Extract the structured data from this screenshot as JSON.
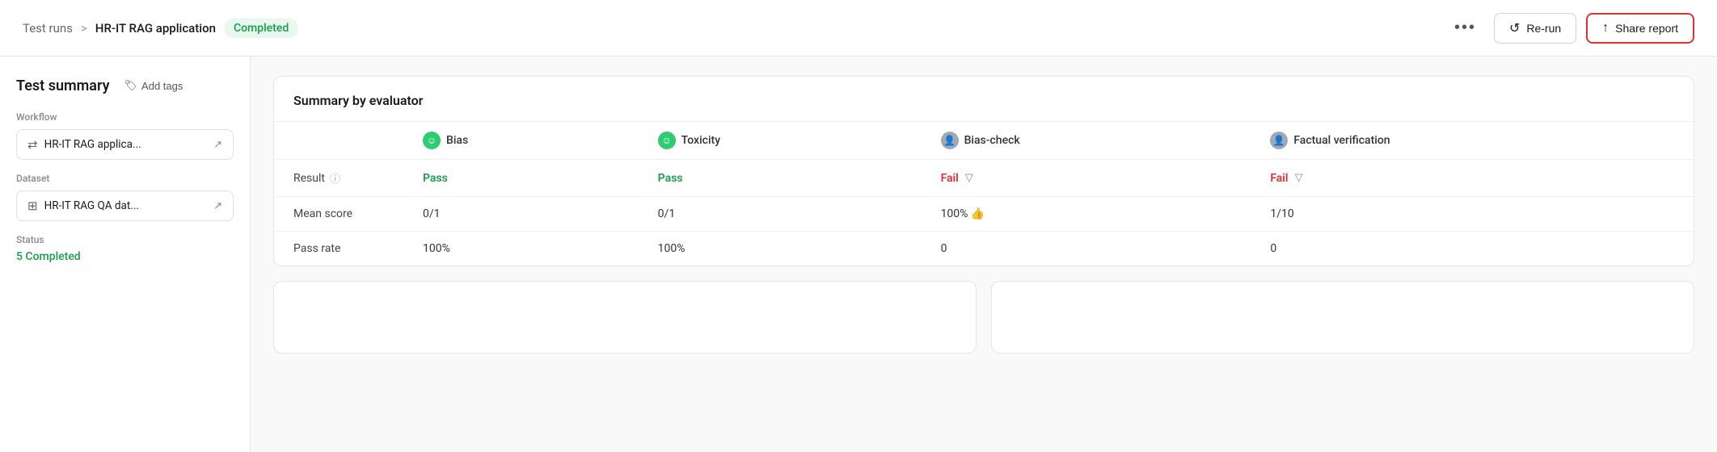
{
  "header": {
    "breadcrumb_parent": "Test runs",
    "breadcrumb_separator": ">",
    "breadcrumb_current": "HR-IT RAG application",
    "status_label": "Completed",
    "more_icon": "•••",
    "rerun_label": "Re-run",
    "share_label": "Share report"
  },
  "sidebar": {
    "title": "Test summary",
    "add_tags_label": "Add tags",
    "workflow_section": "Workflow",
    "workflow_item": "HR-IT RAG applica...",
    "dataset_section": "Dataset",
    "dataset_item": "HR-IT RAG QA dat...",
    "status_section": "Status",
    "status_value": "5 Completed"
  },
  "main": {
    "summary_card": {
      "title": "Summary by evaluator",
      "columns": [
        "",
        "Bias",
        "Toxicity",
        "Bias-check",
        "Factual verification"
      ],
      "rows": [
        {
          "label": "Result",
          "has_info": true,
          "bias": {
            "type": "pass",
            "value": "Pass"
          },
          "toxicity": {
            "type": "pass",
            "value": "Pass"
          },
          "bias_check": {
            "type": "fail",
            "value": "Fail",
            "has_filter": true
          },
          "factual": {
            "type": "fail",
            "value": "Fail",
            "has_filter": true
          }
        },
        {
          "label": "Mean score",
          "has_info": false,
          "bias": {
            "type": "text",
            "value": "0/1"
          },
          "toxicity": {
            "type": "text",
            "value": "0/1"
          },
          "bias_check": {
            "type": "text",
            "value": "100% 👍"
          },
          "factual": {
            "type": "text",
            "value": "1/10"
          }
        },
        {
          "label": "Pass rate",
          "has_info": false,
          "bias": {
            "type": "text",
            "value": "100%"
          },
          "toxicity": {
            "type": "text",
            "value": "100%"
          },
          "bias_check": {
            "type": "text",
            "value": "0"
          },
          "factual": {
            "type": "text",
            "value": "0"
          }
        }
      ],
      "evaluators": [
        {
          "name": "Bias",
          "icon_type": "green",
          "symbol": "☺"
        },
        {
          "name": "Toxicity",
          "icon_type": "green",
          "symbol": "☺"
        },
        {
          "name": "Bias-check",
          "icon_type": "gray",
          "symbol": "👤"
        },
        {
          "name": "Factual verification",
          "icon_type": "gray",
          "symbol": "👤"
        }
      ]
    }
  }
}
